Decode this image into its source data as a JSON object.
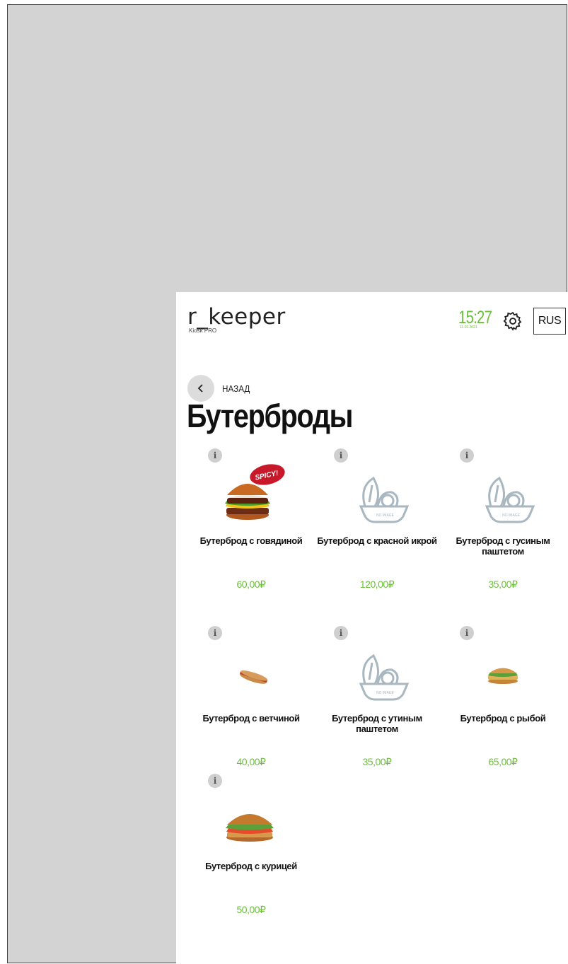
{
  "brand": {
    "name": "r_keeper",
    "subtitle": "Kiosk PRO"
  },
  "header": {
    "time": "15:27",
    "date": "11.02.2021",
    "language": "RUS"
  },
  "nav": {
    "back_label": "НАЗАД"
  },
  "page_title": "Бутерброды",
  "icons": {
    "info": "i",
    "back": "chevron-left-icon",
    "settings": "gear-icon"
  },
  "colors": {
    "accent": "#6bbf3a",
    "background": "#d3d3d3",
    "spicy_badge": "#c8192a"
  },
  "items": [
    {
      "name": "Бутерброд с говядиной",
      "price": "60,00₽",
      "badge": "SPICY!"
    },
    {
      "name": "Бутерброд с красной икрой",
      "price": "120,00₽",
      "placeholder": "NO IMAGE"
    },
    {
      "name": "Бутерброд с гусиным паштетом",
      "price": "35,00₽",
      "placeholder": "NO IMAGE"
    },
    {
      "name": "Бутерброд с ветчиной",
      "price": "40,00₽"
    },
    {
      "name": "Бутерброд с утиным паштетом",
      "price": "35,00₽",
      "placeholder": "NO IMAGE"
    },
    {
      "name": "Бутерброд с рыбой",
      "price": "65,00₽"
    },
    {
      "name": "Бутерброд с курицей",
      "price": "50,00₽"
    }
  ]
}
